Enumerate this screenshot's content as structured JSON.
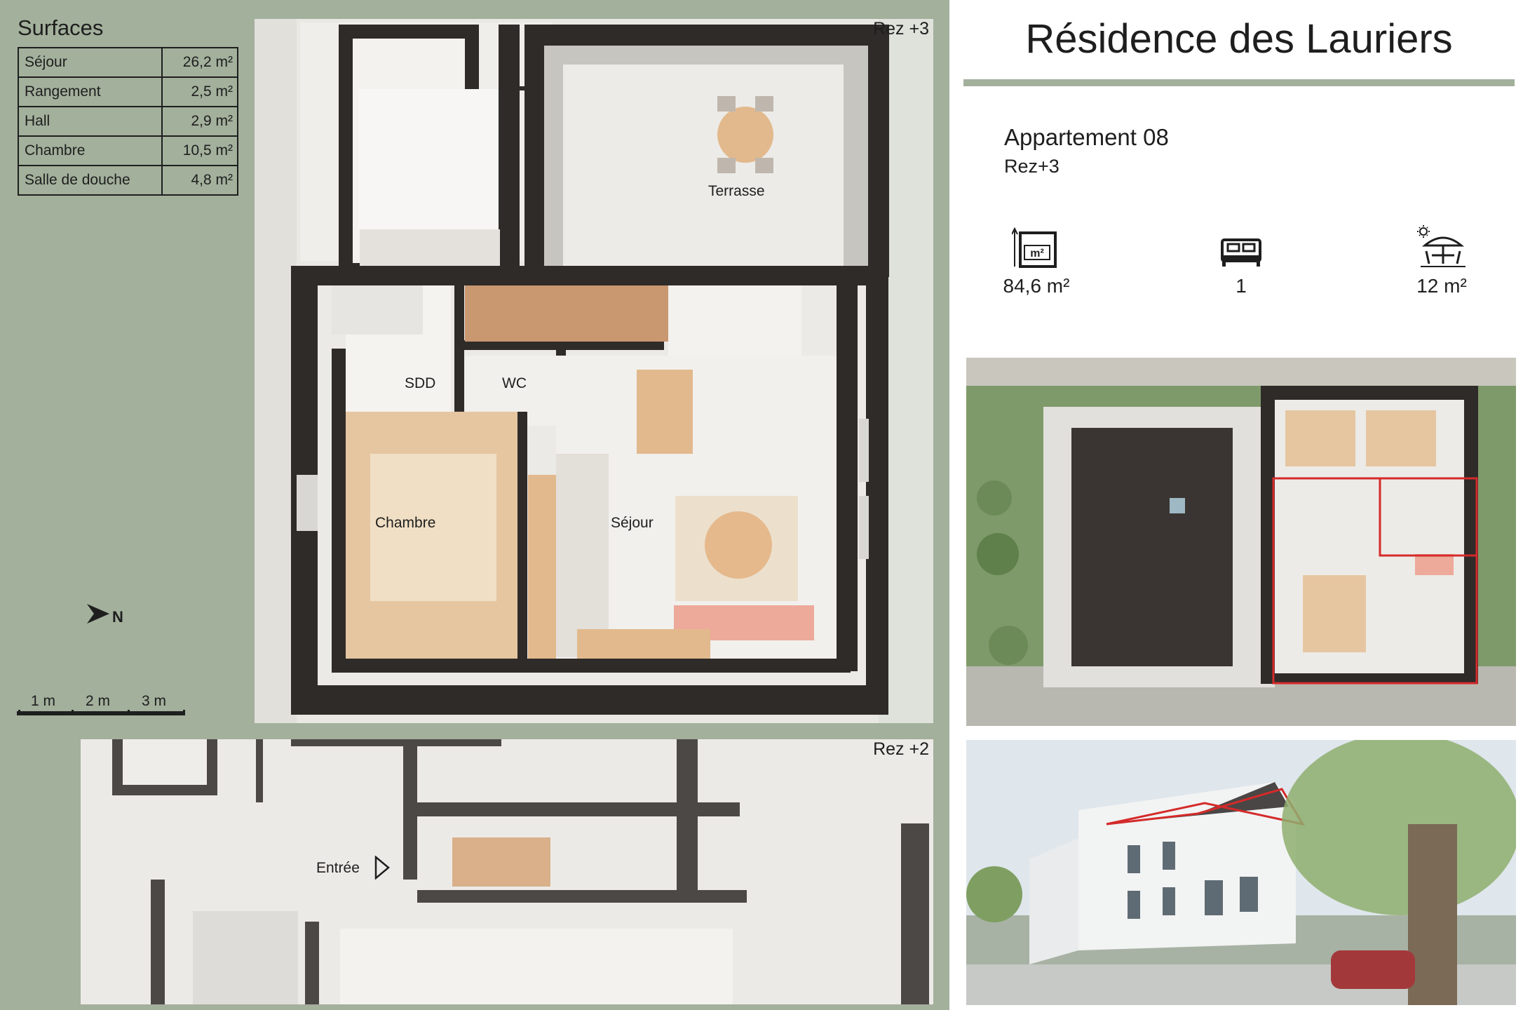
{
  "surfaces": {
    "title": "Surfaces",
    "rows": [
      {
        "room": "Séjour",
        "area": "26,2 m²"
      },
      {
        "room": "Rangement",
        "area": "2,5 m²"
      },
      {
        "room": "Hall",
        "area": "2,9 m²"
      },
      {
        "room": "Chambre",
        "area": "10,5 m²"
      },
      {
        "room": "Salle de douche",
        "area": "4,8 m²"
      }
    ]
  },
  "north_arrow": {
    "letter": "N"
  },
  "scale_bar": {
    "labels": [
      "1 m",
      "2 m",
      "3 m"
    ]
  },
  "plan_rez3": {
    "floor_label": "Rez +3",
    "rooms": {
      "terrasse": "Terrasse",
      "sdd": "SDD",
      "wc": "WC",
      "chambre": "Chambre",
      "sejour": "Séjour"
    }
  },
  "plan_rez2": {
    "floor_label": "Rez +2",
    "entree": "Entrée"
  },
  "header": {
    "title": "Résidence des Lauriers",
    "apartment": "Appartement 08",
    "floor": "Rez+3"
  },
  "stats": {
    "area": {
      "icon": "floor-area-icon",
      "icon_text": "m²",
      "value": "84,6 m²"
    },
    "bedrooms": {
      "icon": "bed-icon",
      "value": "1"
    },
    "terrace": {
      "icon": "terrace-parasol-icon",
      "value": "12 m²"
    }
  },
  "colors": {
    "sage": "#a3b09c",
    "wall": "#2e2b29",
    "highlight": "#d42a2a",
    "wood": "#e2b98d",
    "sofa": "#eda99a"
  }
}
